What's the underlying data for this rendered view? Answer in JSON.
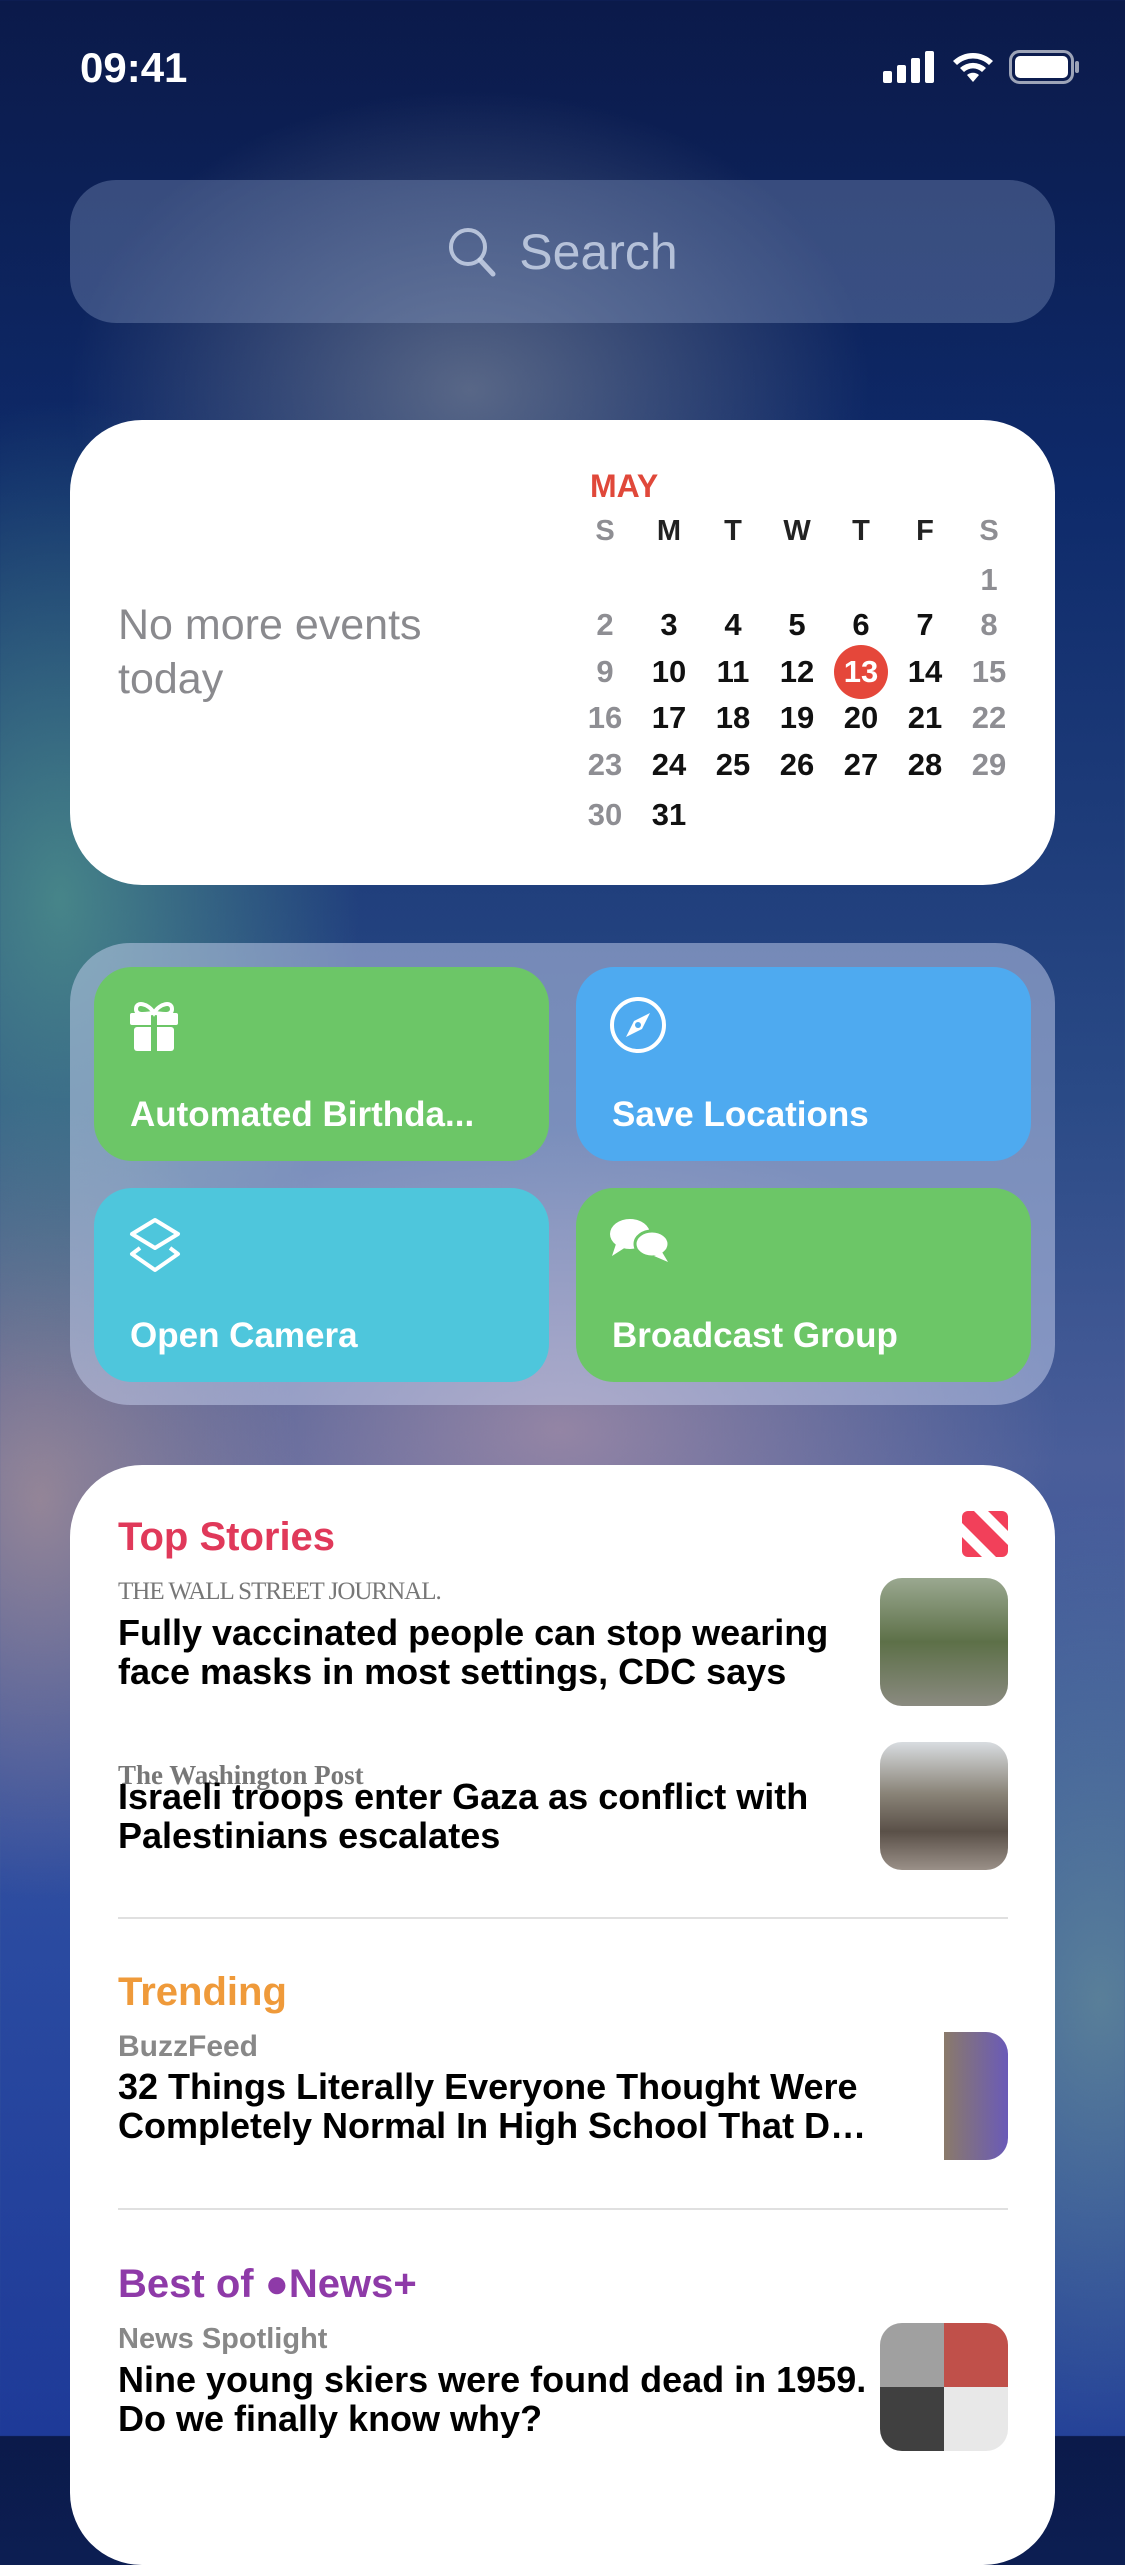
{
  "status": {
    "time": "09:41",
    "icons": [
      "cellular-signal-icon",
      "wifi-icon",
      "battery-icon"
    ]
  },
  "search": {
    "placeholder": "Search"
  },
  "calendar": {
    "events_text": "No more events today",
    "month": "MAY",
    "weekdays": [
      "S",
      "M",
      "T",
      "W",
      "T",
      "F",
      "S"
    ],
    "weeks": [
      [
        "",
        "",
        "",
        "",
        "",
        "",
        "1"
      ],
      [
        "2",
        "3",
        "4",
        "5",
        "6",
        "7",
        "8"
      ],
      [
        "9",
        "10",
        "11",
        "12",
        "13",
        "14",
        "15"
      ],
      [
        "16",
        "17",
        "18",
        "19",
        "20",
        "21",
        "22"
      ],
      [
        "23",
        "24",
        "25",
        "26",
        "27",
        "28",
        "29"
      ],
      [
        "30",
        "31",
        "",
        "",
        "",
        "",
        ""
      ]
    ],
    "today": "13",
    "accent": "#e5473a"
  },
  "shortcuts": [
    {
      "label": "Automated Birthda...",
      "icon": "gift-icon",
      "color": "#6cc667"
    },
    {
      "label": "Save Locations",
      "icon": "compass-icon",
      "color": "#4eaaf0"
    },
    {
      "label": "Open Camera",
      "icon": "shortcuts-icon",
      "color": "#4ec6dc"
    },
    {
      "label": "Broadcast Group",
      "icon": "chat-bubbles-icon",
      "color": "#6cc667"
    }
  ],
  "news": {
    "top_stories": {
      "title": "Top Stories",
      "color": "#e0395a",
      "items": [
        {
          "source": "THE WALL STREET JOURNAL.",
          "headline": [
            "Fully vaccinated people can stop wearing",
            "face masks in most settings, CDC says"
          ]
        },
        {
          "source": "The Washington Post",
          "headline": [
            "Israeli troops enter Gaza as conflict with",
            "Palestinians escalates"
          ]
        }
      ]
    },
    "trending": {
      "title": "Trending",
      "color": "#ef9a3a",
      "items": [
        {
          "source": "BuzzFeed",
          "headline": [
            "32 Things Literally Everyone Thought Were",
            "Completely Normal In High School That De..."
          ]
        }
      ]
    },
    "news_plus": {
      "title": "Best of News+",
      "title_display": "Best of ",
      "title_brand": "News+",
      "color": "#8e3aa8",
      "items": [
        {
          "source": "News Spotlight",
          "headline": [
            "Nine young skiers were found dead in 1959.",
            "Do we finally know why?"
          ]
        }
      ]
    }
  }
}
